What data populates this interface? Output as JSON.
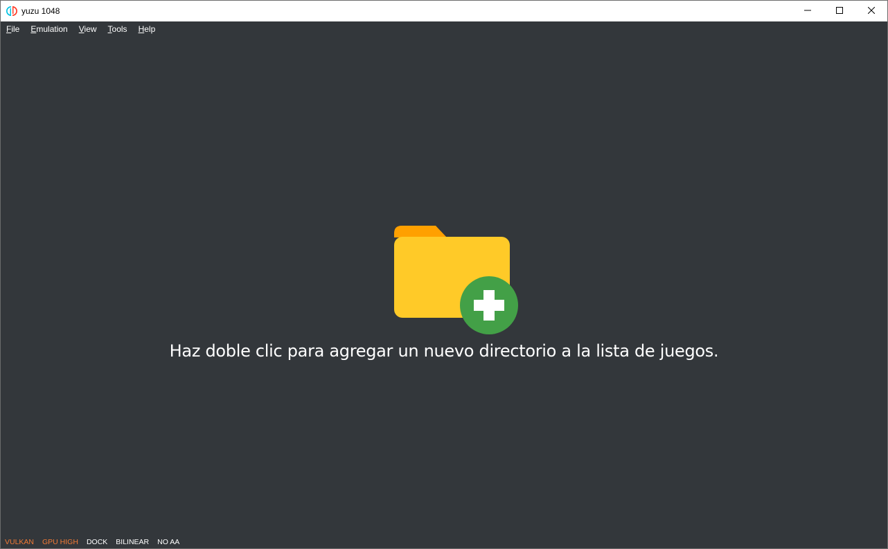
{
  "window": {
    "title": "yuzu 1048"
  },
  "titlebar": {
    "minimize_icon": "minimize-icon",
    "maximize_icon": "maximize-icon",
    "close_icon": "close-icon"
  },
  "menu": {
    "items": [
      {
        "accel": "F",
        "rest": "ile"
      },
      {
        "accel": "E",
        "rest": "mulation"
      },
      {
        "accel": "V",
        "rest": "iew"
      },
      {
        "accel": "T",
        "rest": "ools"
      },
      {
        "accel": "H",
        "rest": "elp"
      }
    ]
  },
  "game_list": {
    "empty_icon": "add-folder-icon",
    "empty_message": "Haz doble clic para agregar un nuevo directorio a la lista de juegos."
  },
  "status": {
    "renderer": "VULKAN",
    "gpu_accuracy": "GPU HIGH",
    "dock_mode": "DOCK",
    "filter": "BILINEAR",
    "anti_aliasing": "NO AA"
  },
  "colors": {
    "background": "#33373b",
    "warning_text": "#f27a35",
    "folder_back": "#ffa000",
    "folder_front": "#ffca28",
    "plus_circle": "#43a047"
  }
}
